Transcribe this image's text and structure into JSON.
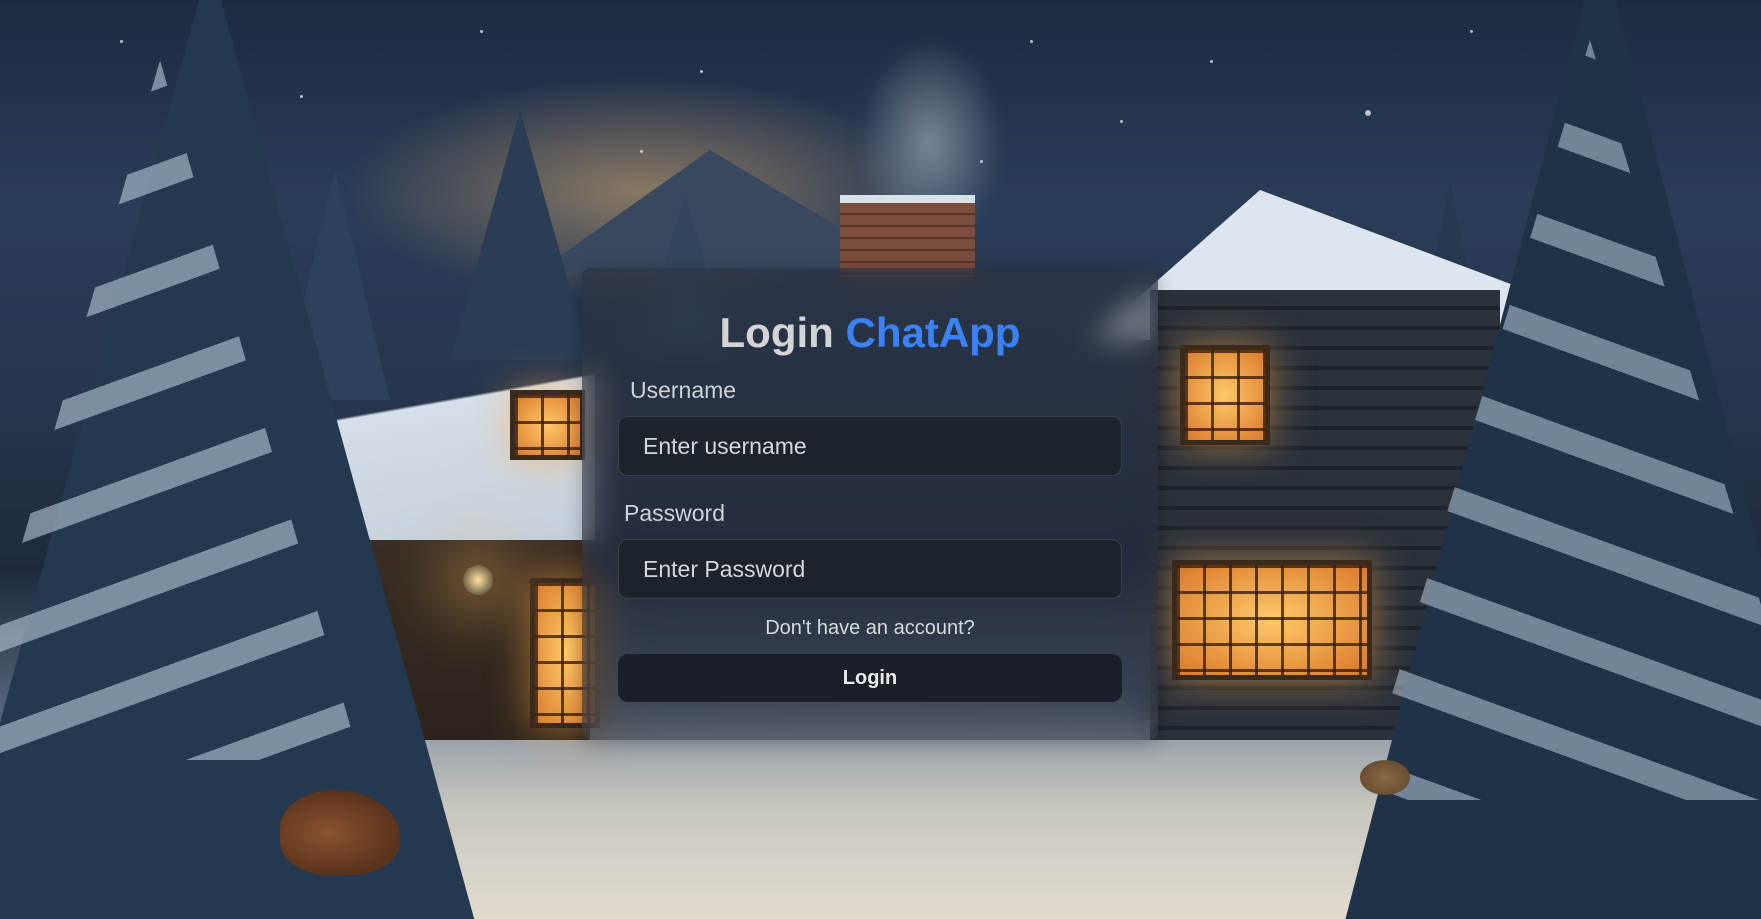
{
  "login": {
    "title_prefix": "Login",
    "title_brand": "ChatApp",
    "username_label": "Username",
    "username_placeholder": "Enter username",
    "username_value": "",
    "password_label": "Password",
    "password_placeholder": "Enter Password",
    "password_value": "",
    "signup_link": "Don't have an account?",
    "submit_label": "Login"
  },
  "theme": {
    "accent": "#3b82f6",
    "input_background": "#1d232b",
    "button_background": "#1b2028",
    "card_background": "rgba(40, 48, 60, 0.55)"
  },
  "background": {
    "subject": "snowy-log-cabin-night-illustration"
  }
}
